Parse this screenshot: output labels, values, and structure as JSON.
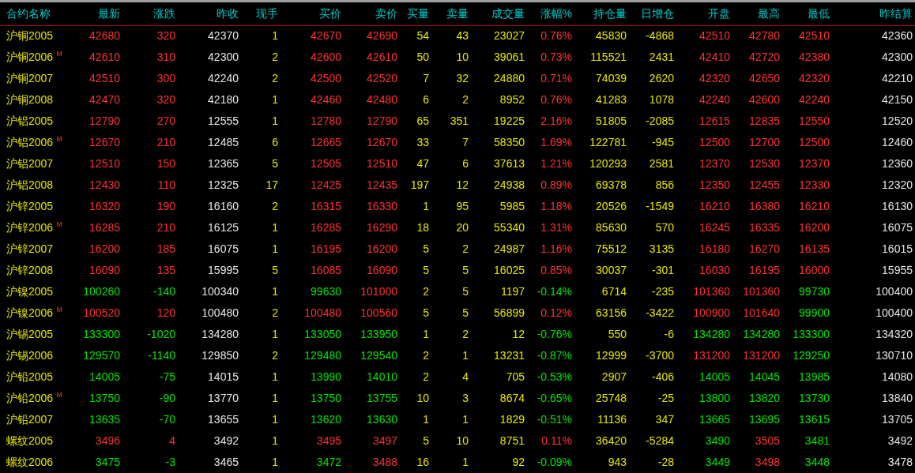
{
  "columns": [
    {
      "label": "合约名称",
      "kind": "name"
    },
    {
      "label": "最新",
      "kind": "price"
    },
    {
      "label": "涨跌",
      "kind": "price"
    },
    {
      "label": "昨收",
      "kind": "reference"
    },
    {
      "label": "现手",
      "kind": "quantity"
    },
    {
      "label": "买价",
      "kind": "price"
    },
    {
      "label": "卖价",
      "kind": "price"
    },
    {
      "label": "买量",
      "kind": "quantity"
    },
    {
      "label": "卖量",
      "kind": "quantity"
    },
    {
      "label": "成交量",
      "kind": "quantity"
    },
    {
      "label": "涨幅%",
      "kind": "price"
    },
    {
      "label": "持仓量",
      "kind": "quantity"
    },
    {
      "label": "日增仓",
      "kind": "quantity"
    },
    {
      "label": "开盘",
      "kind": "price"
    },
    {
      "label": "最高",
      "kind": "price"
    },
    {
      "label": "最低",
      "kind": "price"
    },
    {
      "label": "昨结算",
      "kind": "reference"
    }
  ],
  "rows": [
    {
      "name": "沪铜2005",
      "cells": [
        {
          "text": "42680",
          "up": true
        },
        {
          "text": "320",
          "up": true
        },
        "42370",
        "1",
        {
          "text": "42670",
          "up": true
        },
        {
          "text": "42690",
          "up": true
        },
        "54",
        "43",
        "23027",
        {
          "text": "0.76%",
          "up": true
        },
        "45830",
        "-4868",
        {
          "text": "42510",
          "up": true
        },
        {
          "text": "42780",
          "up": true
        },
        {
          "text": "42510",
          "up": true
        },
        "42360"
      ]
    },
    {
      "name": "沪铜2006",
      "mark": "M",
      "cells": [
        {
          "text": "42610",
          "up": true
        },
        {
          "text": "310",
          "up": true
        },
        "42300",
        "2",
        {
          "text": "42600",
          "up": true
        },
        {
          "text": "42610",
          "up": true
        },
        "50",
        "10",
        "39061",
        {
          "text": "0.73%",
          "up": true
        },
        "115521",
        "2431",
        {
          "text": "42410",
          "up": true
        },
        {
          "text": "42720",
          "up": true
        },
        {
          "text": "42380",
          "up": true
        },
        "42300"
      ]
    },
    {
      "name": "沪铜2007",
      "cells": [
        {
          "text": "42510",
          "up": true
        },
        {
          "text": "300",
          "up": true
        },
        "42240",
        "2",
        {
          "text": "42500",
          "up": true
        },
        {
          "text": "42520",
          "up": true
        },
        "7",
        "32",
        "24880",
        {
          "text": "0.71%",
          "up": true
        },
        "74039",
        "2620",
        {
          "text": "42320",
          "up": true
        },
        {
          "text": "42650",
          "up": true
        },
        {
          "text": "42320",
          "up": true
        },
        "42210"
      ]
    },
    {
      "name": "沪铜2008",
      "cells": [
        {
          "text": "42470",
          "up": true
        },
        {
          "text": "320",
          "up": true
        },
        "42180",
        "1",
        {
          "text": "42460",
          "up": true
        },
        {
          "text": "42480",
          "up": true
        },
        "6",
        "2",
        "8952",
        {
          "text": "0.76%",
          "up": true
        },
        "41283",
        "1078",
        {
          "text": "42240",
          "up": true
        },
        {
          "text": "42600",
          "up": true
        },
        {
          "text": "42240",
          "up": true
        },
        "42150"
      ]
    },
    {
      "name": "沪铝2005",
      "cells": [
        {
          "text": "12790",
          "up": true
        },
        {
          "text": "270",
          "up": true
        },
        "12555",
        "1",
        {
          "text": "12780",
          "up": true
        },
        {
          "text": "12790",
          "up": true
        },
        "65",
        "351",
        "19225",
        {
          "text": "2.16%",
          "up": true
        },
        "51805",
        "-2085",
        {
          "text": "12615",
          "up": true
        },
        {
          "text": "12835",
          "up": true
        },
        {
          "text": "12550",
          "up": true
        },
        "12520"
      ]
    },
    {
      "name": "沪铝2006",
      "mark": "M",
      "cells": [
        {
          "text": "12670",
          "up": true
        },
        {
          "text": "210",
          "up": true
        },
        "12485",
        "6",
        {
          "text": "12665",
          "up": true
        },
        {
          "text": "12670",
          "up": true
        },
        "33",
        "7",
        "58350",
        {
          "text": "1.69%",
          "up": true
        },
        "122781",
        "-945",
        {
          "text": "12500",
          "up": true
        },
        {
          "text": "12700",
          "up": true
        },
        {
          "text": "12500",
          "up": true
        },
        "12460"
      ]
    },
    {
      "name": "沪铝2007",
      "cells": [
        {
          "text": "12510",
          "up": true
        },
        {
          "text": "150",
          "up": true
        },
        "12365",
        "5",
        {
          "text": "12505",
          "up": true
        },
        {
          "text": "12510",
          "up": true
        },
        "47",
        "6",
        "37613",
        {
          "text": "1.21%",
          "up": true
        },
        "120293",
        "2581",
        {
          "text": "12370",
          "up": true
        },
        {
          "text": "12530",
          "up": true
        },
        {
          "text": "12370",
          "up": true
        },
        "12360"
      ]
    },
    {
      "name": "沪铝2008",
      "cells": [
        {
          "text": "12430",
          "up": true
        },
        {
          "text": "110",
          "up": true
        },
        "12325",
        "17",
        {
          "text": "12425",
          "up": true
        },
        {
          "text": "12435",
          "up": true
        },
        "197",
        "12",
        "24938",
        {
          "text": "0.89%",
          "up": true
        },
        "69378",
        "856",
        {
          "text": "12350",
          "up": true
        },
        {
          "text": "12455",
          "up": true
        },
        {
          "text": "12330",
          "up": true
        },
        "12320"
      ]
    },
    {
      "name": "沪锌2005",
      "cells": [
        {
          "text": "16320",
          "up": true
        },
        {
          "text": "190",
          "up": true
        },
        "16160",
        "2",
        {
          "text": "16315",
          "up": true
        },
        {
          "text": "16330",
          "up": true
        },
        "1",
        "95",
        "5985",
        {
          "text": "1.18%",
          "up": true
        },
        "20526",
        "-1549",
        {
          "text": "16210",
          "up": true
        },
        {
          "text": "16380",
          "up": true
        },
        {
          "text": "16210",
          "up": true
        },
        "16130"
      ]
    },
    {
      "name": "沪锌2006",
      "mark": "M",
      "cells": [
        {
          "text": "16285",
          "up": true
        },
        {
          "text": "210",
          "up": true
        },
        "16125",
        "1",
        {
          "text": "16285",
          "up": true
        },
        {
          "text": "16290",
          "up": true
        },
        "18",
        "20",
        "55340",
        {
          "text": "1.31%",
          "up": true
        },
        "85630",
        "570",
        {
          "text": "16245",
          "up": true
        },
        {
          "text": "16335",
          "up": true
        },
        {
          "text": "16200",
          "up": true
        },
        "16075"
      ]
    },
    {
      "name": "沪锌2007",
      "cells": [
        {
          "text": "16200",
          "up": true
        },
        {
          "text": "185",
          "up": true
        },
        "16075",
        "1",
        {
          "text": "16195",
          "up": true
        },
        {
          "text": "16200",
          "up": true
        },
        "5",
        "2",
        "24987",
        {
          "text": "1.16%",
          "up": true
        },
        "75512",
        "3135",
        {
          "text": "16180",
          "up": true
        },
        {
          "text": "16270",
          "up": true
        },
        {
          "text": "16135",
          "up": true
        },
        "16015"
      ]
    },
    {
      "name": "沪锌2008",
      "cells": [
        {
          "text": "16090",
          "up": true
        },
        {
          "text": "135",
          "up": true
        },
        "15995",
        "5",
        {
          "text": "16085",
          "up": true
        },
        {
          "text": "16090",
          "up": true
        },
        "5",
        "5",
        "16025",
        {
          "text": "0.85%",
          "up": true
        },
        "30037",
        "-301",
        {
          "text": "16030",
          "up": true
        },
        {
          "text": "16195",
          "up": true
        },
        {
          "text": "16000",
          "up": true
        },
        "15955"
      ]
    },
    {
      "name": "沪镍2005",
      "cells": [
        {
          "text": "100260",
          "up": false
        },
        {
          "text": "-140",
          "up": false
        },
        "100340",
        "1",
        {
          "text": "99630",
          "up": false
        },
        {
          "text": "101000",
          "up": true
        },
        "2",
        "5",
        "1197",
        {
          "text": "-0.14%",
          "up": false
        },
        "6714",
        "-235",
        {
          "text": "101360",
          "up": true
        },
        {
          "text": "101360",
          "up": true
        },
        {
          "text": "99730",
          "up": false
        },
        "100400"
      ]
    },
    {
      "name": "沪镍2006",
      "mark": "M",
      "cells": [
        {
          "text": "100520",
          "up": true
        },
        {
          "text": "120",
          "up": true
        },
        "100480",
        "2",
        {
          "text": "100480",
          "up": true
        },
        {
          "text": "100560",
          "up": true
        },
        "5",
        "5",
        "56899",
        {
          "text": "0.12%",
          "up": true
        },
        "63156",
        "-3422",
        {
          "text": "100900",
          "up": true
        },
        {
          "text": "101640",
          "up": true
        },
        {
          "text": "99900",
          "up": false
        },
        "100400"
      ]
    },
    {
      "name": "沪锡2005",
      "cells": [
        {
          "text": "133300",
          "up": false
        },
        {
          "text": "-1020",
          "up": false
        },
        "134280",
        "1",
        {
          "text": "133050",
          "up": false
        },
        {
          "text": "133950",
          "up": false
        },
        "1",
        "2",
        "12",
        {
          "text": "-0.76%",
          "up": false
        },
        "550",
        "-6",
        {
          "text": "134280",
          "up": false
        },
        {
          "text": "134280",
          "up": false
        },
        {
          "text": "133300",
          "up": false
        },
        "134320"
      ]
    },
    {
      "name": "沪锡2006",
      "cells": [
        {
          "text": "129570",
          "up": false
        },
        {
          "text": "-1140",
          "up": false
        },
        "129850",
        "2",
        {
          "text": "129480",
          "up": false
        },
        {
          "text": "129540",
          "up": false
        },
        "2",
        "1",
        "13231",
        {
          "text": "-0.87%",
          "up": false
        },
        "12999",
        "-3700",
        {
          "text": "131200",
          "up": true
        },
        {
          "text": "131200",
          "up": true
        },
        {
          "text": "129250",
          "up": false
        },
        "130710"
      ]
    },
    {
      "name": "沪铅2005",
      "cells": [
        {
          "text": "14005",
          "up": false
        },
        {
          "text": "-75",
          "up": false
        },
        "14015",
        "1",
        {
          "text": "13990",
          "up": false
        },
        {
          "text": "14010",
          "up": false
        },
        "2",
        "4",
        "705",
        {
          "text": "-0.53%",
          "up": false
        },
        "2907",
        "-406",
        {
          "text": "14005",
          "up": false
        },
        {
          "text": "14045",
          "up": false
        },
        {
          "text": "13985",
          "up": false
        },
        "14080"
      ]
    },
    {
      "name": "沪铅2006",
      "mark": "M",
      "cells": [
        {
          "text": "13750",
          "up": false
        },
        {
          "text": "-90",
          "up": false
        },
        "13770",
        "1",
        {
          "text": "13750",
          "up": false
        },
        {
          "text": "13755",
          "up": false
        },
        "10",
        "3",
        "8674",
        {
          "text": "-0.65%",
          "up": false
        },
        "25748",
        "-25",
        {
          "text": "13800",
          "up": false
        },
        {
          "text": "13820",
          "up": false
        },
        {
          "text": "13730",
          "up": false
        },
        "13840"
      ]
    },
    {
      "name": "沪铅2007",
      "cells": [
        {
          "text": "13635",
          "up": false
        },
        {
          "text": "-70",
          "up": false
        },
        "13655",
        "1",
        {
          "text": "13620",
          "up": false
        },
        {
          "text": "13630",
          "up": false
        },
        "1",
        "1",
        "1829",
        {
          "text": "-0.51%",
          "up": false
        },
        "11136",
        "347",
        {
          "text": "13665",
          "up": false
        },
        {
          "text": "13695",
          "up": false
        },
        {
          "text": "13615",
          "up": false
        },
        "13705"
      ]
    },
    {
      "name": "螺纹2005",
      "cells": [
        {
          "text": "3496",
          "up": true
        },
        {
          "text": "4",
          "up": true
        },
        "3492",
        "1",
        {
          "text": "3495",
          "up": true
        },
        {
          "text": "3497",
          "up": true
        },
        "5",
        "10",
        "8751",
        {
          "text": "0.11%",
          "up": true
        },
        "36420",
        "-5284",
        {
          "text": "3490",
          "up": false
        },
        {
          "text": "3505",
          "up": true
        },
        {
          "text": "3481",
          "up": false
        },
        "3492"
      ]
    },
    {
      "name": "螺纹2006",
      "cells": [
        {
          "text": "3475",
          "up": false
        },
        {
          "text": "-3",
          "up": false
        },
        "3465",
        "1",
        {
          "text": "3472",
          "up": false
        },
        {
          "text": "3488",
          "up": true
        },
        "16",
        "1",
        "92",
        {
          "text": "-0.09%",
          "up": false
        },
        "943",
        "-28",
        {
          "text": "3449",
          "up": false
        },
        {
          "text": "3498",
          "up": true
        },
        {
          "text": "3448",
          "up": false
        },
        "3478"
      ]
    }
  ]
}
